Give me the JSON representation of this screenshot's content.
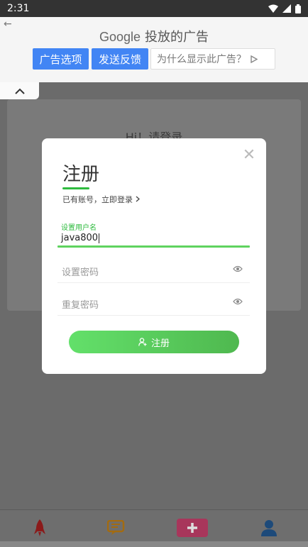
{
  "status_bar": {
    "time": "2:31"
  },
  "ad": {
    "brand": "Google",
    "title": "投放的广告",
    "options_label": "广告选项",
    "feedback_label": "发送反馈",
    "why_label": "为什么显示此广告？"
  },
  "background": {
    "greeting": "Hi！请登录"
  },
  "modal": {
    "title": "注册",
    "login_link": "已有账号，立即登录",
    "username_label": "设置用户名",
    "username_value": "java800",
    "password_placeholder": "设置密码",
    "confirm_placeholder": "重复密码",
    "register_label": "注册"
  },
  "colors": {
    "accent": "#2fbb3f",
    "ad_button": "#4285f4"
  }
}
